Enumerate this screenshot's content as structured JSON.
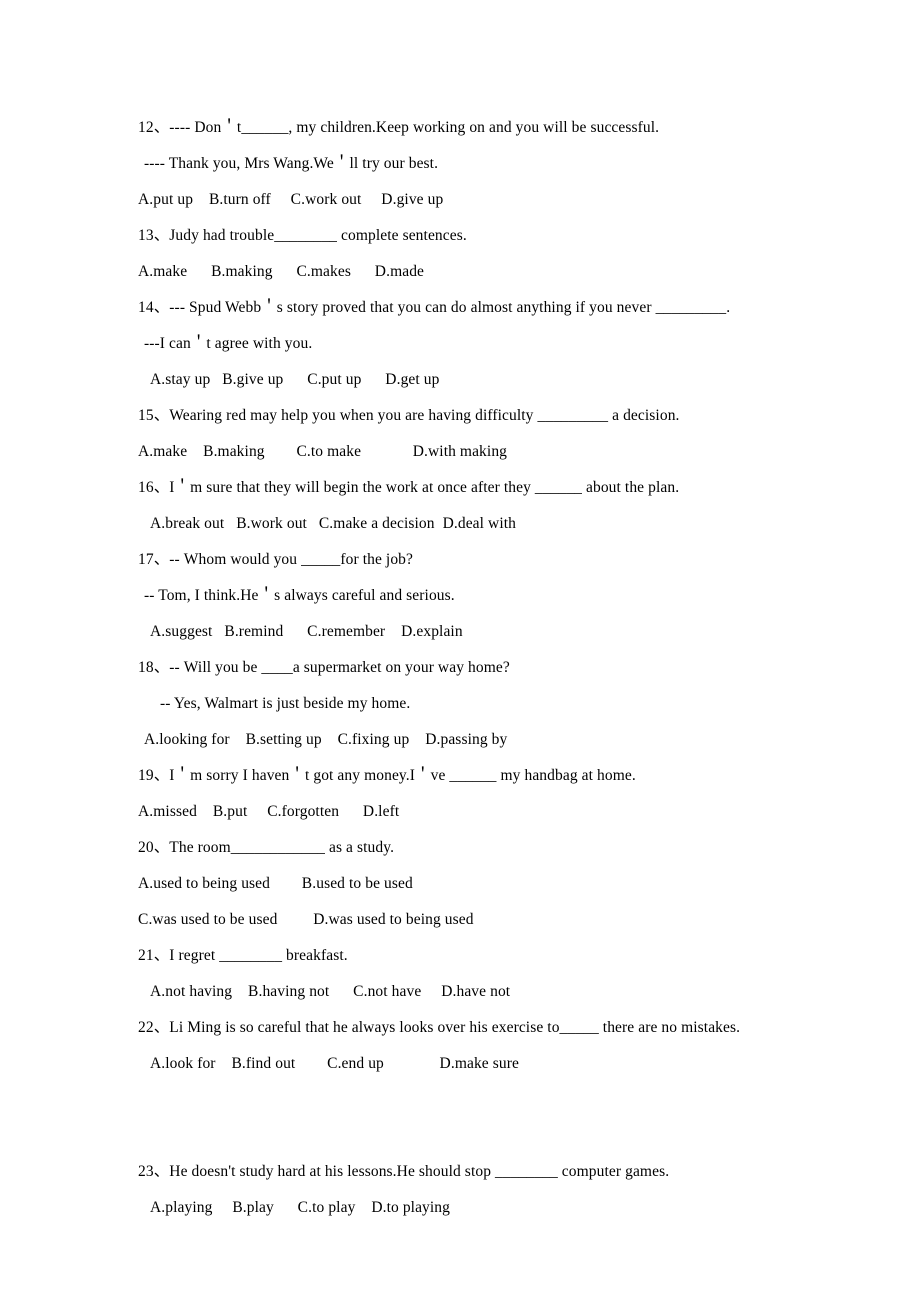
{
  "document": {
    "type": "english-grammar-multiple-choice-worksheet",
    "number_separator": "、",
    "lines": [
      {
        "id": "q12-stem",
        "indent": 0,
        "text": "12、---- Don＇t______, my children.Keep working on and you will be successful."
      },
      {
        "id": "q12-reply",
        "indent": 1,
        "text": "---- Thank you, Mrs Wang.We＇ll try our best."
      },
      {
        "id": "q12-options",
        "indent": 0,
        "text": "A.put up    B.turn off     C.work out     D.give up"
      },
      {
        "id": "q13-stem",
        "indent": 0,
        "text": "13、Judy had trouble________ complete sentences."
      },
      {
        "id": "q13-options",
        "indent": 0,
        "text": "A.make      B.making      C.makes      D.made"
      },
      {
        "id": "q14-stem",
        "indent": 0,
        "text": "14、--- Spud Webb＇s story proved that you can do almost anything if you never _________."
      },
      {
        "id": "q14-reply",
        "indent": 1,
        "text": "---I can＇t agree with you."
      },
      {
        "id": "q14-options",
        "indent": 2,
        "text": "A.stay up   B.give up      C.put up      D.get up"
      },
      {
        "id": "q15-stem",
        "indent": 0,
        "text": "15、Wearing red may help you when you are having difficulty _________ a decision."
      },
      {
        "id": "q15-options",
        "indent": 0,
        "text": "A.make    B.making        C.to make             D.with making"
      },
      {
        "id": "q16-stem",
        "indent": 0,
        "text": "16、I＇m sure that they will begin the work at once after they ______ about the plan."
      },
      {
        "id": "q16-options",
        "indent": 2,
        "text": "A.break out   B.work out   C.make a decision  D.deal with"
      },
      {
        "id": "q17-stem",
        "indent": 0,
        "text": "17、-- Whom would you _____for the job?"
      },
      {
        "id": "q17-reply",
        "indent": 1,
        "text": "-- Tom, I think.He＇s always careful and serious."
      },
      {
        "id": "q17-options",
        "indent": 2,
        "text": "A.suggest   B.remind      C.remember    D.explain"
      },
      {
        "id": "q18-stem",
        "indent": 0,
        "text": "18、-- Will you be ____a supermarket on your way home?"
      },
      {
        "id": "q18-reply",
        "indent": 3,
        "text": "-- Yes, Walmart is just beside my home."
      },
      {
        "id": "q18-options",
        "indent": 1,
        "text": "A.looking for    B.setting up    C.fixing up    D.passing by"
      },
      {
        "id": "q19-stem",
        "indent": 0,
        "text": "19、I＇m sorry I haven＇t got any money.I＇ve ______ my handbag at home."
      },
      {
        "id": "q19-options",
        "indent": 0,
        "text": "A.missed    B.put     C.forgotten      D.left"
      },
      {
        "id": "q20-stem",
        "indent": 0,
        "text": "20、The room____________ as a study."
      },
      {
        "id": "q20-options-ab",
        "indent": 0,
        "text": "A.used to being used        B.used to be used"
      },
      {
        "id": "q20-options-cd",
        "indent": 0,
        "text": "C.was used to be used         D.was used to being used"
      },
      {
        "id": "q21-stem",
        "indent": 0,
        "text": "21、I regret ________ breakfast."
      },
      {
        "id": "q21-options",
        "indent": 2,
        "text": "A.not having    B.having not      C.not have     D.have not"
      },
      {
        "id": "q22-stem",
        "indent": 0,
        "text": "22、Li Ming is so careful that he always looks over his exercise to_____ there are no mistakes."
      },
      {
        "id": "q22-options",
        "indent": 2,
        "text": "A.look for    B.find out        C.end up              D.make sure"
      },
      {
        "id": "gap-before-q23",
        "indent": 0,
        "text": "",
        "spacer": 2
      },
      {
        "id": "q23-stem",
        "indent": 0,
        "text": "23、He doesn't study hard at his lessons.He should stop ________ computer games."
      },
      {
        "id": "q23-options",
        "indent": 2,
        "text": "A.playing     B.play      C.to play    D.to playing"
      }
    ]
  }
}
